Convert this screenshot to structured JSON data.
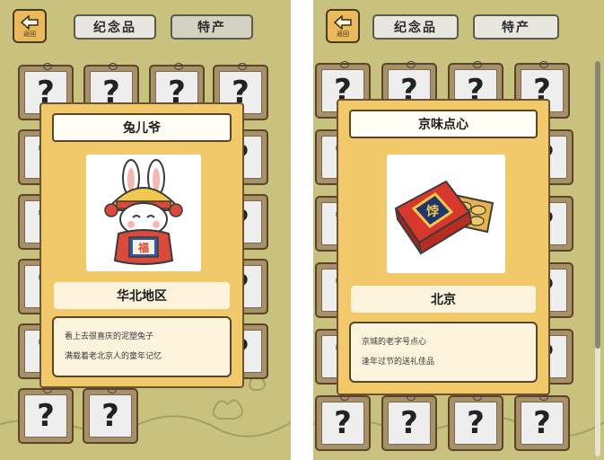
{
  "left": {
    "back_label": "返回",
    "tabs": {
      "souvenir": "纪念品",
      "specialty": "特产"
    },
    "grid_placeholder": "?",
    "popup": {
      "title": "兔儿爷",
      "region": "华北地区",
      "description": [
        "看上去很喜庆的泥塑兔子",
        "满载着老北京人的童年记忆"
      ],
      "image_badge": "福"
    }
  },
  "right": {
    "back_label": "返回",
    "tabs": {
      "souvenir": "纪念品",
      "specialty": "特产"
    },
    "grid_placeholder": "?",
    "popup": {
      "title": "京味点心",
      "region": "北京",
      "description": [
        "京城的老字号点心",
        "逢年过节的送礼佳品"
      ],
      "image_badge": "饽"
    }
  },
  "colors": {
    "background": "#c9c27f",
    "card_frame": "#a7916a",
    "popup_bg": "#f1c96b",
    "tab_bg": "#e7e6df"
  }
}
